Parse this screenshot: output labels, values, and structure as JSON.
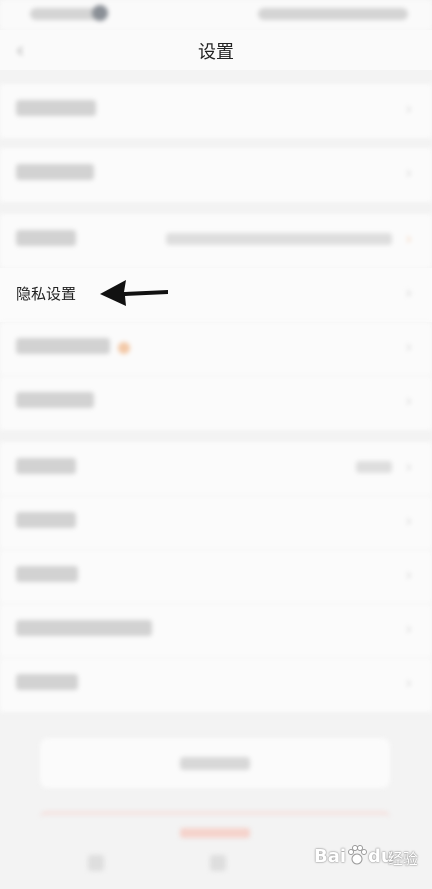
{
  "header": {
    "title": "设置",
    "back_icon": "back-arrow-icon"
  },
  "highlighted_item": {
    "label": "隐私设置"
  },
  "watermark": {
    "brand_1": "Bai",
    "brand_2": "du",
    "cn": "经验",
    "logo": "paw-icon"
  },
  "colors": {
    "badge": "#f3c9a8",
    "red_accent": "#f5d3cc",
    "background": "#f3f3f3"
  }
}
